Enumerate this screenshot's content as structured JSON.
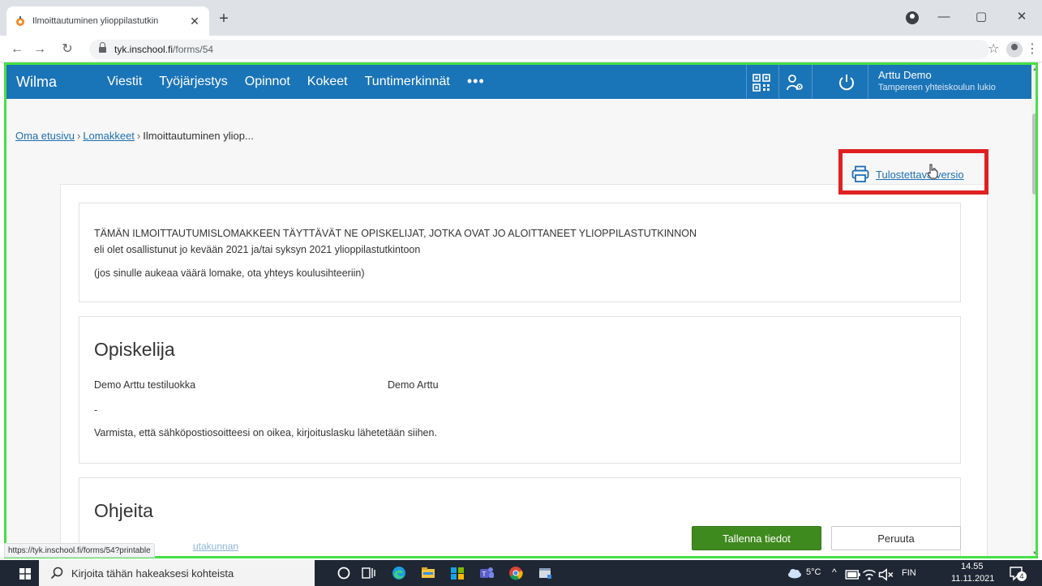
{
  "browser": {
    "tab_title": "Ilmoittautuminen ylioppilastutkin",
    "url_host": "tyk.inschool.fi",
    "url_path": "/forms/54",
    "status_url": "https://tyk.inschool.fi/forms/54?printable"
  },
  "nav": {
    "brand": "Wilma",
    "items": [
      {
        "label": "Viestit"
      },
      {
        "label": "Työjärjestys"
      },
      {
        "label": "Opinnot"
      },
      {
        "label": "Kokeet"
      },
      {
        "label": "Tuntimerkinnät"
      }
    ],
    "more": "•••",
    "user_name": "Arttu Demo",
    "user_school": "Tampereen yhteiskoulun lukio"
  },
  "breadcrumb": {
    "home": "Oma etusivu",
    "forms": "Lomakkeet",
    "sep": "›",
    "current": "Ilmoittautuminen yliop..."
  },
  "print_link": "Tulostettava versio",
  "panel1": {
    "line1": "TÄMÄN ILMOITTAUTUMISLOMAKKEEN TÄYTTÄVÄT NE OPISKELIJAT, JOTKA OVAT JO ALOITTANEET YLIOPPILASTUTKINNON",
    "line2": "eli olet osallistunut jo kevään 2021 ja/tai syksyn 2021 ylioppilastutkintoon",
    "line3": "(jos sinulle aukeaa väärä lomake, ota yhteys koulusihteeriin)"
  },
  "panel2": {
    "title": "Opiskelija",
    "class": "Demo Arttu testiluokka",
    "name": "Demo Arttu",
    "dash": "-",
    "note": "Varmista, että sähköpostiosoitteesi on oikea, kirjoituslasku lähetetään siihen."
  },
  "panel3": {
    "title": "Ohjeita",
    "link_partial": "utakunnan"
  },
  "buttons": {
    "save": "Tallenna tiedot",
    "cancel": "Peruuta"
  },
  "taskbar": {
    "search_placeholder": "Kirjoita tähän hakeaksesi kohteista",
    "temperature": "5°C",
    "language": "FIN",
    "time": "14.55",
    "date": "11.11.2021",
    "notification_count": "4"
  },
  "colors": {
    "nav_blue": "#1a74b8",
    "save_green": "#3f8a1e",
    "highlight_red": "#e02020",
    "frame_green": "#46e046",
    "link_blue": "#1f6fb5"
  }
}
